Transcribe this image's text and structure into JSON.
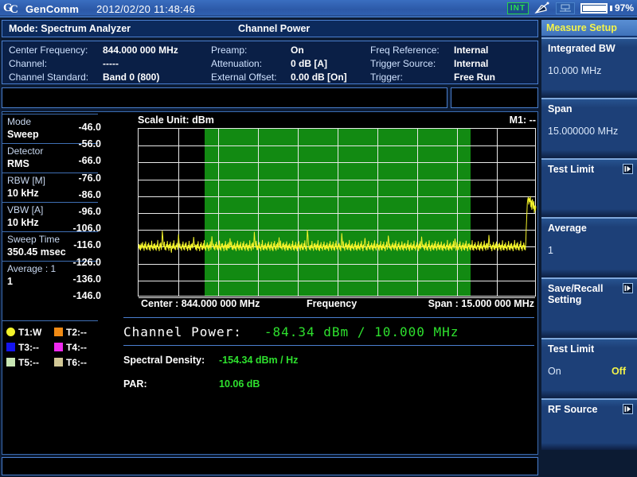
{
  "titlebar": {
    "app_name": "GenComm",
    "datetime": "2012/02/20 11:48:46",
    "int_badge": "INT",
    "battery_pct": "97%",
    "icons": [
      "gc-logo-icon",
      "satellite-dish-icon",
      "network-icon",
      "battery-icon"
    ]
  },
  "modebar": {
    "mode": "Mode: Spectrum Analyzer",
    "measurement": "Channel Power"
  },
  "info": {
    "col1": [
      {
        "label": "Center Frequency:",
        "value": "844.000 000 MHz"
      },
      {
        "label": "Channel:",
        "value": "-----"
      },
      {
        "label": "Channel Standard:",
        "value": "Band 0 (800)"
      }
    ],
    "col2": [
      {
        "label": "Preamp:",
        "value": "On"
      },
      {
        "label": "Attenuation:",
        "value": "0 dB  [A]"
      },
      {
        "label": "External Offset:",
        "value": "0.00 dB  [On]"
      }
    ],
    "col3": [
      {
        "label": "Freq Reference:",
        "value": "Internal"
      },
      {
        "label": "Trigger Source:",
        "value": "Internal"
      },
      {
        "label": "Trigger:",
        "value": "Free Run"
      }
    ]
  },
  "params": [
    {
      "label": "Mode",
      "value": "Sweep"
    },
    {
      "label": "Detector",
      "value": "RMS"
    },
    {
      "label": "RBW [M]",
      "value": "10 kHz"
    },
    {
      "label": "VBW [A]",
      "value": "10 kHz"
    },
    {
      "label": "Sweep Time",
      "value": "350.45 msec"
    },
    {
      "label": "Average : 1",
      "value": "1"
    }
  ],
  "traces": [
    {
      "name": "T1:W",
      "color": "#f2f22a",
      "shape": "round"
    },
    {
      "name": "T2:--",
      "color": "#f08a14",
      "shape": "square"
    },
    {
      "name": "T3:--",
      "color": "#1414f0",
      "shape": "square"
    },
    {
      "name": "T4:--",
      "color": "#f02af0",
      "shape": "square"
    },
    {
      "name": "T5:--",
      "color": "#c8e6b4",
      "shape": "square"
    },
    {
      "name": "T6:--",
      "color": "#d2c896",
      "shape": "square"
    }
  ],
  "chart_data": {
    "type": "line",
    "title": "",
    "scale_unit_label": "Scale Unit: dBm",
    "marker_label": "M1: --",
    "xlabel": "Frequency",
    "ylabel": "dBm",
    "center_label": "Center : 844.000 000 MHz",
    "span_label": "Span : 15.000 000 MHz",
    "center_hz": 844000000,
    "span_hz": 15000000,
    "ylim": [
      -146.0,
      -46.0
    ],
    "ytick_labels": [
      "-46.0",
      "-56.0",
      "-66.0",
      "-76.0",
      "-86.0",
      "-96.0",
      "-106.0",
      "-116.0",
      "-126.0",
      "-136.0",
      "-146.0"
    ],
    "yticks": [
      -46.0,
      -56.0,
      -66.0,
      -76.0,
      -86.0,
      -96.0,
      -106.0,
      -116.0,
      -126.0,
      -136.0,
      -146.0
    ],
    "grid": true,
    "x_divisions": 10,
    "y_divisions": 10,
    "trace_color": "#f2f22a",
    "integration_band": {
      "color": "#128a12",
      "start_frac": 0.1667,
      "end_frac": 0.8333,
      "bw_label": "10.000 MHz"
    },
    "noise_floor_dbm": -116.0,
    "series": [
      {
        "name": "T1 Sweep RMS",
        "color": "#f2f22a",
        "values": [
          -116.9,
          -114.4,
          -117.6,
          -115.0,
          -118.2,
          -114.0,
          -117.1,
          -115.6,
          -113.2,
          -117.0,
          -115.3,
          -118.4,
          -114.2,
          -116.6,
          -112.8,
          -117.4,
          -115.9,
          -118.0,
          -114.6,
          -116.2,
          -113.6,
          -117.8,
          -115.1,
          -118.5,
          -114.9,
          -116.4,
          -112.4,
          -117.2,
          -115.5,
          -118.1,
          -114.3,
          -116.8,
          -113.9,
          -117.5,
          -115.2,
          -118.3,
          -114.7,
          -116.0,
          -112.0,
          -117.3,
          -115.8,
          -118.6,
          -114.1,
          -116.5,
          -113.4,
          -117.9,
          -115.4,
          -106.5,
          -110.0,
          -114.8,
          -116.3,
          -113.0,
          -117.7,
          -115.7,
          -118.2,
          -114.5,
          -116.1,
          -112.6,
          -117.0,
          -115.0,
          -118.4,
          -114.4,
          -116.7,
          -113.1,
          -117.6,
          -119.5,
          -115.3,
          -117.2,
          -114.0,
          -116.9,
          -112.2,
          -117.4,
          -115.6,
          -118.0,
          -114.8,
          -116.2,
          -113.7,
          -117.8,
          -115.1,
          -108.5,
          -112.3,
          -116.6,
          -114.2,
          -117.1,
          -115.9,
          -118.3,
          -114.6,
          -116.4,
          -112.9,
          -117.5,
          -115.4,
          -118.1,
          -114.1,
          -116.0,
          -113.3,
          -117.3,
          -115.7,
          -118.5,
          -114.9,
          -116.8,
          -112.5,
          -117.9,
          -115.2,
          -118.2,
          -114.4,
          -116.5,
          -113.8,
          -117.0,
          -115.5,
          -110.2,
          -113.6,
          -116.1,
          -114.7,
          -117.6,
          -115.0,
          -118.4,
          -114.3,
          -116.7,
          -112.7,
          -117.2,
          -115.8,
          -118.6,
          -114.5,
          -116.3,
          -113.2,
          -117.7,
          -115.3,
          -118.0,
          -114.0,
          -116.9,
          -112.1,
          -117.4,
          -115.6,
          -118.3,
          -114.8,
          -116.2,
          -113.5,
          -117.1,
          -115.1,
          -118.5,
          -114.6,
          -116.6,
          -112.8,
          -117.8,
          -115.9,
          -109.8,
          -113.4,
          -116.0,
          -114.2,
          -117.3,
          -115.5,
          -118.1,
          -114.4,
          -116.4,
          -113.0,
          -117.5,
          -115.2,
          -118.2,
          -114.9,
          -116.8,
          -112.3,
          -117.6,
          -115.7,
          -118.4,
          -114.1,
          -116.1,
          -113.9,
          -117.0,
          -115.4,
          -118.6,
          -114.7,
          -116.5,
          -112.6,
          -117.9,
          -115.0,
          -118.3,
          -114.3,
          -116.7,
          -113.3,
          -117.2,
          -115.8,
          -111.0,
          -114.5,
          -116.2,
          -112.9,
          -117.7,
          -115.3,
          -118.0,
          -114.8,
          -116.9,
          -113.6,
          -117.4,
          -115.6,
          -118.5,
          -114.2,
          -116.3,
          -112.4,
          -117.1,
          -115.1,
          -118.2,
          -114.6,
          -116.6,
          -113.1,
          -117.8,
          -115.9,
          -118.1,
          -114.0,
          -116.0,
          -112.7,
          -117.3,
          -115.5,
          -118.4,
          -114.4,
          -116.4,
          -113.8,
          -117.6,
          -115.2,
          -118.6,
          -114.9,
          -116.8,
          -112.2,
          -117.0,
          -115.7,
          -118.3,
          -114.1,
          -116.1,
          -113.4,
          -117.5,
          -115.0,
          -107.2,
          -111.5,
          -114.3,
          -116.5,
          -112.5,
          -117.9,
          -115.4,
          -118.0,
          -114.7,
          -116.7,
          -113.2,
          -117.2,
          -115.8,
          -118.5,
          -114.5,
          -116.2,
          -112.0,
          -117.7,
          -115.3,
          -118.1,
          -114.8,
          -116.9,
          -113.7,
          -117.4,
          -115.6,
          -118.2,
          -114.2,
          -116.3,
          -112.9,
          -117.1,
          -115.1,
          -118.4,
          -114.6,
          -116.6,
          -113.0,
          -117.8,
          -115.9,
          -118.6,
          -114.0,
          -116.0,
          -112.6,
          -117.3,
          -115.5,
          -118.3,
          -114.4,
          -116.4,
          -113.5,
          -117.6,
          -115.2,
          -110.5,
          -114.9,
          -116.8,
          -112.3,
          -117.0,
          -115.7,
          -118.0,
          -114.1,
          -116.1,
          -113.3,
          -117.5,
          -115.0,
          -118.5,
          -114.3,
          -116.5,
          -112.8,
          -117.9,
          -115.4,
          -118.2,
          -114.7,
          -116.7,
          -113.9,
          -117.2,
          -115.8,
          -118.1,
          -114.5,
          -116.2,
          -112.4,
          -117.7,
          -115.3,
          -118.4,
          -114.8,
          -116.9,
          -113.1,
          -117.4,
          -115.6,
          -118.6,
          -114.2,
          -116.3,
          -112.7,
          -117.1,
          -115.1,
          -118.3,
          -114.6,
          -116.6,
          -113.6,
          -117.8,
          -115.9,
          -118.0,
          -114.0,
          -116.0,
          -112.2,
          -117.3,
          -115.5,
          -118.5,
          -114.4,
          -106.0,
          -109.0,
          -113.4,
          -116.4,
          -117.6,
          -115.2,
          -118.2,
          -114.9,
          -116.8,
          -112.5,
          -117.0,
          -115.7,
          -118.4,
          -114.1,
          -116.1,
          -113.8,
          -117.5,
          -115.0,
          -118.1,
          -114.3,
          -116.5,
          -112.1,
          -117.9,
          -115.4,
          -118.6,
          -114.7,
          -116.7,
          -113.2,
          -117.2,
          -115.8,
          -118.3,
          -114.5,
          -116.2,
          -112.9,
          -117.7,
          -115.3,
          -118.0,
          -114.8,
          -116.9,
          -113.5,
          -117.4,
          -115.6,
          -118.5,
          -114.2,
          -116.3,
          -112.6,
          -117.1,
          -115.1,
          -118.2,
          -114.6,
          -116.6,
          -113.0,
          -117.8,
          -115.9,
          -118.4,
          -114.0,
          -116.0,
          -112.3,
          -117.3,
          -115.5,
          -118.1,
          -114.4,
          -116.4,
          -113.7,
          -117.6,
          -115.2,
          -118.6,
          -114.9,
          -108.0,
          -111.8,
          -116.8,
          -112.8,
          -117.0,
          -115.7,
          -118.3,
          -114.1,
          -116.1,
          -113.4,
          -117.5,
          -115.0,
          -118.0,
          -114.3,
          -116.5,
          -112.0,
          -117.9,
          -115.4,
          -118.5,
          -114.7,
          -116.7,
          -113.9,
          -117.2,
          -115.8,
          -118.2,
          -114.5,
          -116.2,
          -112.7,
          -117.7,
          -115.3,
          -118.4,
          -114.8,
          -116.9,
          -113.3,
          -117.4,
          -115.6,
          -118.1,
          -114.2,
          -116.3,
          -112.4,
          -117.1,
          -115.1,
          -118.6,
          -114.6,
          -116.6,
          -113.1,
          -110.8,
          -114.0,
          -117.8,
          -115.9,
          -118.3,
          -114.4,
          -116.0,
          -112.5,
          -117.3,
          -115.5,
          -118.0,
          -114.9,
          -116.4,
          -113.6,
          -117.6,
          -115.2,
          -118.5,
          -114.1,
          -116.8,
          -112.2,
          -117.0,
          -115.7,
          -118.2,
          -114.3,
          -116.1,
          -113.8,
          -117.5,
          -115.0,
          -118.4,
          -114.7,
          -116.5,
          -112.6,
          -117.9,
          -115.4,
          -118.1,
          -114.5,
          -116.7,
          -113.0,
          -117.2,
          -115.8,
          -118.6,
          -114.8,
          -116.2,
          -112.9,
          -117.7,
          -115.3,
          -109.4,
          -112.0,
          -116.9,
          -114.2,
          -117.4,
          -115.6,
          -118.3,
          -114.6,
          -116.3,
          -113.4,
          -117.1,
          -115.1,
          -118.0,
          -114.0,
          -116.6,
          -112.3,
          -117.8,
          -115.9,
          -118.5,
          -114.4,
          -116.0,
          -113.2,
          -117.3,
          -115.5,
          -118.2,
          -114.9,
          -116.4,
          -112.8,
          -117.6,
          -115.2,
          -118.4,
          -114.1,
          -116.8,
          -113.7,
          -117.0,
          -115.7,
          -118.1,
          -114.3,
          -116.1,
          -112.1,
          -117.5,
          -115.0,
          -118.6,
          -114.7,
          -116.5,
          -113.5,
          -117.9,
          -115.4,
          -118.0,
          -114.5,
          -116.7,
          -112.4,
          -117.2,
          -115.8,
          -118.3,
          -114.8,
          -116.2,
          -113.3,
          -117.7,
          -115.3,
          -118.5,
          -114.2,
          -116.9,
          -112.7,
          -117.4,
          -115.6,
          -110.0,
          -113.9,
          -116.3,
          -114.6,
          -117.1,
          -115.1,
          -118.2,
          -114.0,
          -116.6,
          -113.0,
          -117.8,
          -115.9,
          -118.4,
          -114.4,
          -116.0,
          -112.2,
          -117.3,
          -115.5,
          -118.6,
          -114.9,
          -116.4,
          -113.6,
          -117.6,
          -115.2,
          -118.1,
          -114.1,
          -116.8,
          -112.5,
          -117.0,
          -115.7,
          -118.3,
          -114.3,
          -116.1,
          -113.1,
          -117.5,
          -115.0,
          -118.0,
          -114.7,
          -116.5,
          -112.9,
          -117.9,
          -115.4,
          -118.5,
          -114.5,
          -116.7,
          -113.8,
          -117.2,
          -115.8,
          -118.2,
          -114.8,
          -116.2,
          -112.0,
          -117.7,
          -115.3,
          -118.4,
          -114.2,
          -116.9,
          -113.4,
          -117.4,
          -115.6,
          -118.1,
          -114.6,
          -116.3,
          -112.6,
          -117.1,
          -115.1,
          -111.2,
          -114.0,
          -118.3,
          -116.6,
          -113.2,
          -117.8,
          -115.9,
          -118.0,
          -114.4,
          -116.0,
          -112.8,
          -117.3,
          -115.5,
          -118.5,
          -114.9,
          -116.4,
          -113.5,
          -117.6,
          -115.2,
          -118.2,
          -114.1,
          -116.8,
          -112.4,
          -117.0,
          -115.7,
          -118.6,
          -114.3,
          -116.1,
          -113.9,
          -117.5,
          -115.0,
          -118.1,
          -114.7,
          -116.5,
          -112.1,
          -117.9,
          -115.4,
          -118.3,
          -114.5,
          -116.7,
          -113.3,
          -117.2,
          -115.8,
          -118.0,
          -114.8,
          -116.2,
          -112.7,
          -117.7,
          -115.3,
          -118.4,
          -114.2,
          -116.9,
          -113.0,
          -117.4,
          -115.6,
          -118.5,
          -114.6,
          -116.3,
          -112.3,
          -117.1,
          -115.1,
          -118.2,
          -114.0,
          -116.6,
          -113.7,
          -117.8,
          -115.9,
          -109.0,
          -112.5,
          -116.0,
          -114.4,
          -117.3,
          -115.5,
          -118.6,
          -114.9,
          -116.4,
          -113.1,
          -117.6,
          -115.2,
          -118.0,
          -114.1,
          -116.8,
          -112.9,
          -117.0,
          -115.7,
          -118.3,
          -114.3,
          -116.1,
          -113.6,
          -117.5,
          -115.0,
          -118.5,
          -114.7,
          -116.5,
          -112.2,
          -117.9,
          -115.4,
          -118.1,
          -114.5,
          -116.7,
          -113.4,
          -117.2,
          -115.8,
          -118.4,
          -114.8,
          -116.2,
          -112.6,
          -117.7,
          -115.3,
          -118.2,
          -114.2,
          -116.9,
          -113.8,
          -117.4,
          -115.6,
          -118.6,
          -114.6,
          -116.3,
          -112.0,
          -117.1,
          -115.1,
          -118.0,
          -114.0,
          -116.6,
          -113.2,
          -117.8,
          -115.9,
          -118.3,
          -114.4,
          -116.0,
          -112.4,
          -117.3,
          -115.5,
          -118.5,
          -114.9,
          -116.4,
          -113.5,
          -117.6,
          -115.2,
          -118.1,
          -114.1,
          -105.0,
          -97.5,
          -90.5,
          -88.0,
          -86.5,
          -91.0,
          -87.2,
          -89.5,
          -86.0,
          -92.5,
          -88.5,
          -94.0,
          -87.8,
          -90.0,
          -93.5,
          -89.0,
          -96.0,
          -91.5,
          -94.5,
          -92.0
        ]
      }
    ]
  },
  "results": {
    "channel_power_label": "Channel Power:",
    "channel_power_value": "-84.34 dBm / 10.000 MHz",
    "rows": [
      {
        "label": "Spectral Density:",
        "value": "-154.34 dBm / Hz"
      },
      {
        "label": "PAR:",
        "value": "10.06 dB"
      }
    ]
  },
  "rightmenu": {
    "header": "Measure Setup",
    "items": [
      {
        "title": "Integrated BW",
        "value": "10.000 MHz",
        "submenu": false,
        "toggle": null
      },
      {
        "title": "Span",
        "value": "15.000000 MHz",
        "submenu": false,
        "toggle": null
      },
      {
        "title": "Test Limit",
        "value": "",
        "submenu": true,
        "toggle": null
      },
      {
        "title": "Average",
        "value": "1",
        "submenu": false,
        "toggle": null
      },
      {
        "title": "Save/Recall Setting",
        "value": "",
        "submenu": true,
        "toggle": null
      },
      {
        "title": "Test Limit",
        "value": "",
        "submenu": false,
        "toggle": {
          "on": "On",
          "off": "Off"
        }
      },
      {
        "title": "RF Source",
        "value": "",
        "submenu": true,
        "toggle": null
      }
    ]
  }
}
